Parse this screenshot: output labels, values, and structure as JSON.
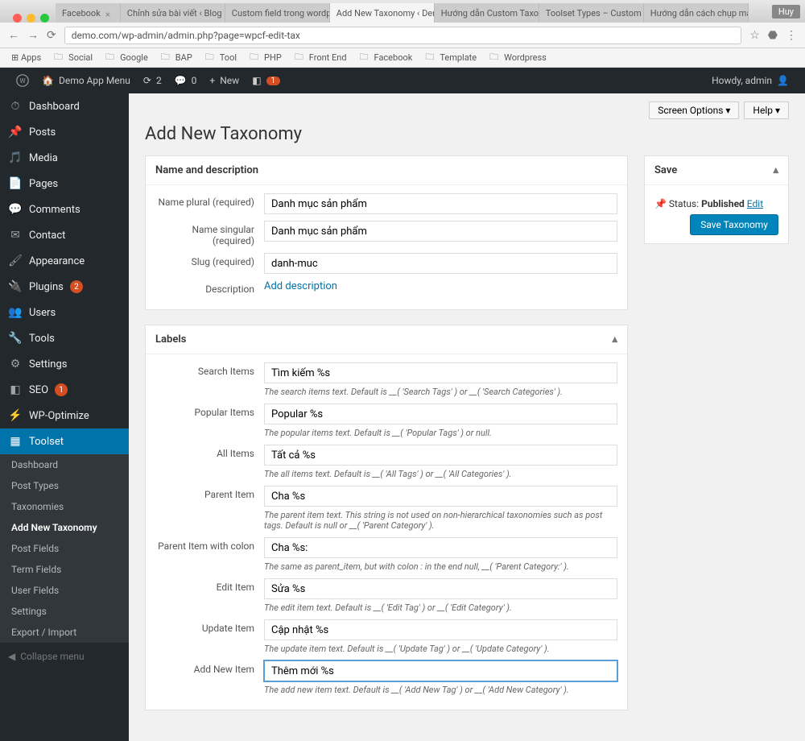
{
  "browser": {
    "user_chip": "Huy",
    "tabs": [
      {
        "label": "Facebook"
      },
      {
        "label": "Chỉnh sửa bài viết ‹ Blog Hu"
      },
      {
        "label": "Custom field trong wordpre"
      },
      {
        "label": "Add New Taxonomy ‹ Demo",
        "active": true
      },
      {
        "label": "Hướng dẫn Custom Taxono"
      },
      {
        "label": "Toolset Types – Custom Pos"
      },
      {
        "label": "Hướng dẫn cách chụp màn h"
      }
    ],
    "url": "demo.com/wp-admin/admin.php?page=wpcf-edit-tax",
    "bookmarks": [
      "Apps",
      "Social",
      "Google",
      "BAP",
      "Tool",
      "PHP",
      "Front End",
      "Facebook",
      "Template",
      "Wordpress"
    ]
  },
  "adminbar": {
    "site": "Demo App Menu",
    "updates": "2",
    "comments": "0",
    "new": "New",
    "notif": "1",
    "howdy": "Howdy, admin"
  },
  "screen_options": "Screen Options",
  "help": "Help",
  "sidebar": {
    "items": [
      {
        "icon": "dashboard",
        "label": "Dashboard"
      },
      {
        "icon": "pin",
        "label": "Posts"
      },
      {
        "icon": "media",
        "label": "Media"
      },
      {
        "icon": "page",
        "label": "Pages"
      },
      {
        "icon": "comment",
        "label": "Comments"
      },
      {
        "icon": "contact",
        "label": "Contact"
      },
      {
        "icon": "brush",
        "label": "Appearance"
      },
      {
        "icon": "plugin",
        "label": "Plugins",
        "badge": "2"
      },
      {
        "icon": "users",
        "label": "Users"
      },
      {
        "icon": "tools",
        "label": "Tools"
      },
      {
        "icon": "settings",
        "label": "Settings"
      },
      {
        "icon": "seo",
        "label": "SEO",
        "badge": "1"
      },
      {
        "icon": "wpo",
        "label": "WP-Optimize"
      },
      {
        "icon": "toolset",
        "label": "Toolset",
        "current": true
      }
    ],
    "sub": [
      "Dashboard",
      "Post Types",
      "Taxonomies",
      "Add New Taxonomy",
      "Post Fields",
      "Term Fields",
      "User Fields",
      "Settings",
      "Export / Import"
    ],
    "sub_current": "Add New Taxonomy",
    "collapse": "Collapse menu"
  },
  "page": {
    "title": "Add New Taxonomy",
    "box1_title": "Name and description",
    "fields": {
      "name_plural": {
        "label": "Name plural (required)",
        "value": "Danh mục sản phẩm"
      },
      "name_singular": {
        "label": "Name singular (required)",
        "value": "Danh mục sản phẩm"
      },
      "slug": {
        "label": "Slug (required)",
        "value": "danh-muc"
      },
      "description": {
        "label": "Description",
        "link": "Add description"
      }
    },
    "box2_title": "Labels",
    "labels": [
      {
        "label": "Search Items",
        "value": "Tìm kiếm %s",
        "help": "The search items text. Default is __( 'Search Tags' ) or __( 'Search Categories' )."
      },
      {
        "label": "Popular Items",
        "value": "Popular %s",
        "help": "The popular items text. Default is __( 'Popular Tags' ) or null."
      },
      {
        "label": "All Items",
        "value": "Tất cả %s",
        "help": "The all items text. Default is __( 'All Tags' ) or __( 'All Categories' )."
      },
      {
        "label": "Parent Item",
        "value": "Cha %s",
        "help": "The parent item text. This string is not used on non-hierarchical taxonomies such as post tags. Default is null or __( 'Parent Category' )."
      },
      {
        "label": "Parent Item with colon",
        "value": "Cha %s:",
        "help": "The same as parent_item, but with colon : in the end null, __( 'Parent Category:' )."
      },
      {
        "label": "Edit Item",
        "value": "Sửa %s",
        "help": "The edit item text. Default is __( 'Edit Tag' ) or __( 'Edit Category' )."
      },
      {
        "label": "Update Item",
        "value": "Cập nhật %s",
        "help": "The update item text. Default is __( 'Update Tag' ) or __( 'Update Category' )."
      },
      {
        "label": "Add New Item",
        "value": "Thêm mới %s",
        "help": "The add new item text. Default is __( 'Add New Tag' ) or __( 'Add New Category' ).",
        "focus": true
      }
    ],
    "save": {
      "title": "Save",
      "status_label": "Status:",
      "status_value": "Published",
      "edit": "Edit",
      "button": "Save Taxonomy"
    }
  }
}
